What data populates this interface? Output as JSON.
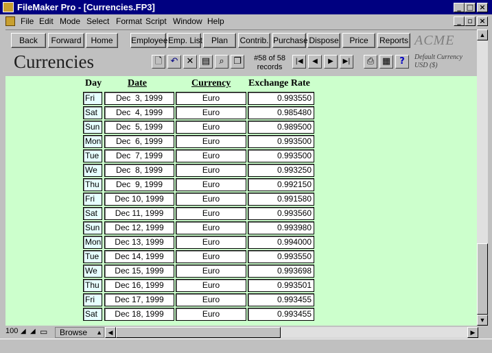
{
  "window": {
    "title": "FileMaker Pro - [Currencies.FP3]",
    "minimize": "_",
    "maximize": "□",
    "close": "×"
  },
  "menu": [
    "File",
    "Edit",
    "Mode",
    "Select",
    "Format",
    "Script",
    "Window",
    "Help"
  ],
  "nav_buttons": [
    "Back",
    "Forward",
    "Home",
    "Employee",
    "Emp. List",
    "Plan",
    "Contrib.",
    "Purchase",
    "Dispose",
    "Price",
    "Reports"
  ],
  "brand": "ACME",
  "page_title": "Currencies",
  "records": {
    "current": "#58 of 58",
    "label": "records"
  },
  "default_currency": {
    "line1": "Default Currency",
    "line2": "USD ($)"
  },
  "columns": {
    "day": "Day",
    "date": "Date",
    "currency": "Currency",
    "rate": "Exchange Rate"
  },
  "rows": [
    {
      "day": "Fri",
      "date": "Dec  3, 1999",
      "currency": "Euro",
      "rate": "0.993550"
    },
    {
      "day": "Sat",
      "date": "Dec  4, 1999",
      "currency": "Euro",
      "rate": "0.985480"
    },
    {
      "day": "Sun",
      "date": "Dec  5, 1999",
      "currency": "Euro",
      "rate": "0.989500"
    },
    {
      "day": "Mon",
      "date": "Dec  6, 1999",
      "currency": "Euro",
      "rate": "0.993500"
    },
    {
      "day": "Tue",
      "date": "Dec  7, 1999",
      "currency": "Euro",
      "rate": "0.993500"
    },
    {
      "day": "We",
      "date": "Dec  8, 1999",
      "currency": "Euro",
      "rate": "0.993250"
    },
    {
      "day": "Thu",
      "date": "Dec  9, 1999",
      "currency": "Euro",
      "rate": "0.992150"
    },
    {
      "day": "Fri",
      "date": "Dec 10, 1999",
      "currency": "Euro",
      "rate": "0.991580"
    },
    {
      "day": "Sat",
      "date": "Dec 11, 1999",
      "currency": "Euro",
      "rate": "0.993560"
    },
    {
      "day": "Sun",
      "date": "Dec 12, 1999",
      "currency": "Euro",
      "rate": "0.993980"
    },
    {
      "day": "Mon",
      "date": "Dec 13, 1999",
      "currency": "Euro",
      "rate": "0.994000"
    },
    {
      "day": "Tue",
      "date": "Dec 14, 1999",
      "currency": "Euro",
      "rate": "0.993550"
    },
    {
      "day": "We",
      "date": "Dec 15, 1999",
      "currency": "Euro",
      "rate": "0.993698"
    },
    {
      "day": "Thu",
      "date": "Dec 16, 1999",
      "currency": "Euro",
      "rate": "0.993501"
    },
    {
      "day": "Fri",
      "date": "Dec 17, 1999",
      "currency": "Euro",
      "rate": "0.993455"
    },
    {
      "day": "Sat",
      "date": "Dec 18, 1999",
      "currency": "Euro",
      "rate": "0.993455"
    }
  ],
  "status": {
    "zoom": "100",
    "mode": "Browse"
  },
  "colors": {
    "content_bg": "#ccffcc",
    "day_cell_bg": "#e6ffff",
    "titlebar": "#000080"
  }
}
